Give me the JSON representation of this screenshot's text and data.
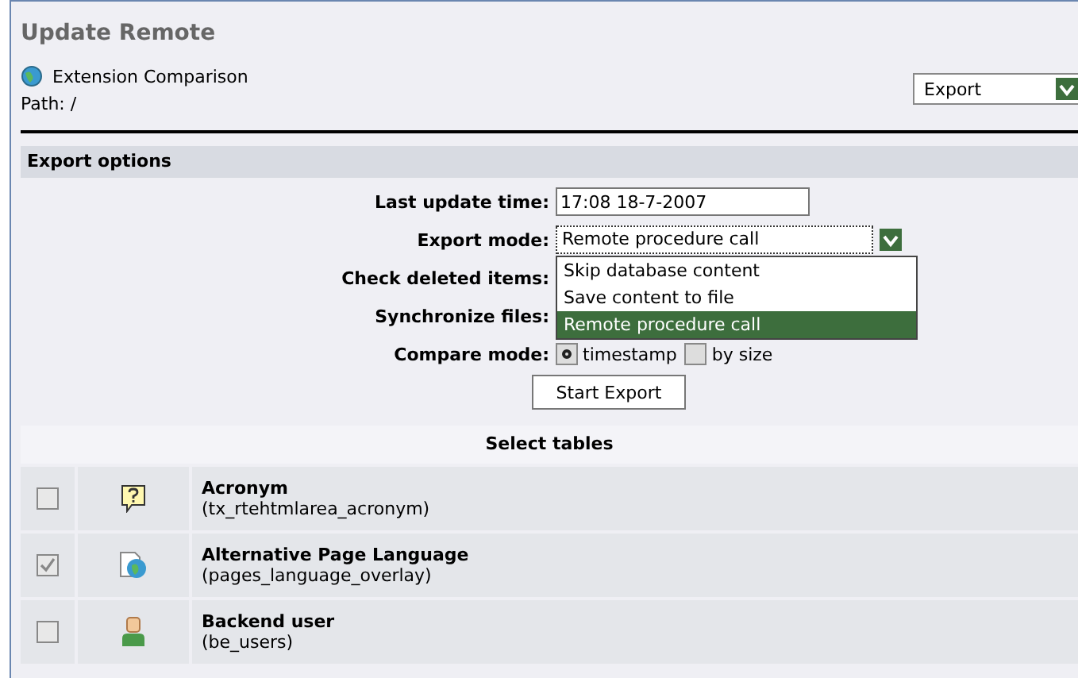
{
  "title": "Update Remote",
  "location": {
    "name": "Extension Comparison",
    "path": "Path: /"
  },
  "action_select": {
    "value": "Export"
  },
  "export_options": {
    "heading": "Export options",
    "fields": [
      {
        "label": "Last update time:",
        "kind": "text",
        "value": "17:08 18-7-2007"
      },
      {
        "label": "Export mode:",
        "kind": "select",
        "value": "Remote procedure call",
        "open": true,
        "options": [
          {
            "label": "Skip database content",
            "selected": false
          },
          {
            "label": "Save content to file",
            "selected": false
          },
          {
            "label": "Remote procedure call",
            "selected": true
          }
        ]
      },
      {
        "label": "Check deleted items:",
        "kind": "hidden"
      },
      {
        "label": "Synchronize files:",
        "kind": "hidden"
      },
      {
        "label": "Compare mode:",
        "kind": "radios",
        "options": [
          {
            "label": "timestamp",
            "selected": true
          },
          {
            "label": "by size",
            "selected": false
          }
        ]
      }
    ],
    "button": "Start Export"
  },
  "tables": {
    "heading": "Select tables",
    "rows": [
      {
        "name": "Acronym",
        "table": "(tx_rtehtmlarea_acronym)",
        "checked": false
      },
      {
        "name": "Alternative Page Language",
        "table": "(pages_language_overlay)",
        "checked": true
      },
      {
        "name": "Backend user",
        "table": "(be_users)",
        "checked": false
      }
    ]
  }
}
